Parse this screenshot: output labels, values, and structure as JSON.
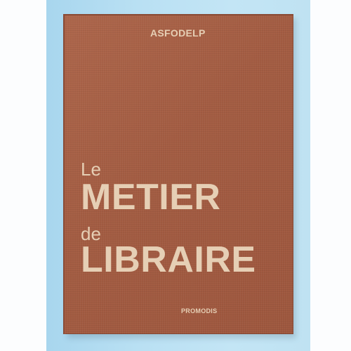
{
  "cover": {
    "author": "ASFODELP",
    "title_line1": "Le",
    "title_line2": "METIER",
    "title_line3": "de",
    "title_line4": "LIBRAIRE",
    "publisher": "PROMODIS"
  },
  "colors": {
    "cover": "#a65f45",
    "lettering": "#e6cfb5",
    "background": "#b9e0f3"
  }
}
